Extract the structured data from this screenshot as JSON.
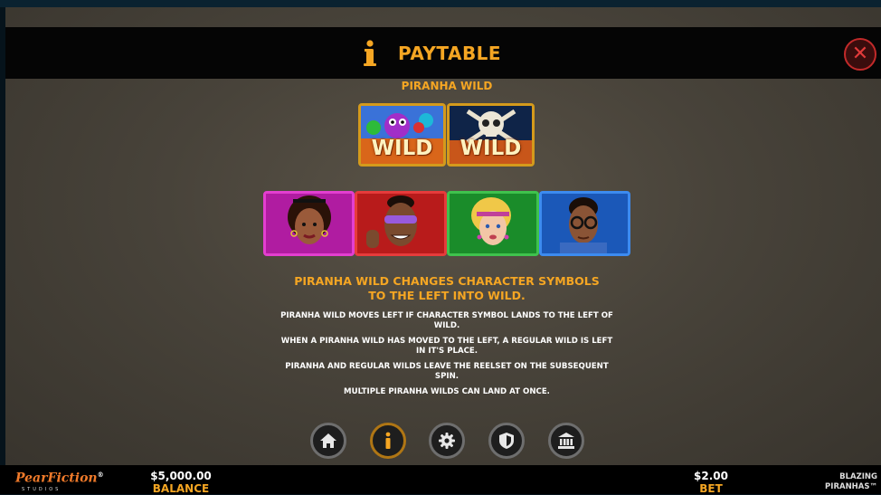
{
  "header": {
    "title": "PAYTABLE",
    "info_icon": "info-icon",
    "close_icon": "close-icon",
    "accent_color": "#f5a623",
    "close_color": "#e23a3a"
  },
  "section": {
    "title": "PIRANHA WILD",
    "wild_symbols": [
      {
        "label": "WILD",
        "icon": "piranha-wild-symbol"
      },
      {
        "label": "WILD",
        "icon": "skull-wild-symbol"
      }
    ],
    "character_symbols": [
      {
        "icon": "character-pink-woman",
        "color": "#c21fb0"
      },
      {
        "icon": "character-red-man",
        "color": "#c81e1e"
      },
      {
        "icon": "character-green-woman",
        "color": "#1c9a2c"
      },
      {
        "icon": "character-blue-man",
        "color": "#1f66c9"
      }
    ],
    "headline": "PIRANHA WILD CHANGES CHARACTER SYMBOLS TO THE LEFT INTO WILD.",
    "rules": [
      "PIRANHA WILD MOVES LEFT IF CHARACTER SYMBOL LANDS TO THE LEFT OF WILD.",
      "WHEN A PIRANHA WILD HAS MOVED TO THE LEFT, A REGULAR WILD IS LEFT IN IT'S PLACE.",
      "PIRANHA AND REGULAR WILDS LEAVE THE REELSET ON THE SUBSEQUENT SPIN.",
      "MULTIPLE PIRANHA WILDS CAN LAND AT ONCE."
    ]
  },
  "nav": {
    "buttons": [
      "home-icon",
      "info-icon",
      "gear-icon",
      "shield-icon",
      "bank-icon"
    ],
    "active": "info-icon"
  },
  "footer": {
    "logo": "PearFiction",
    "logo_mark": "®",
    "logo_sub": "STUDIOS",
    "balance_value": "$5,000.00",
    "balance_label": "BALANCE",
    "bet_value": "$2.00",
    "bet_label": "BET",
    "game_name_line1": "BLAZING",
    "game_name_line2": "PIRANHAS™"
  }
}
